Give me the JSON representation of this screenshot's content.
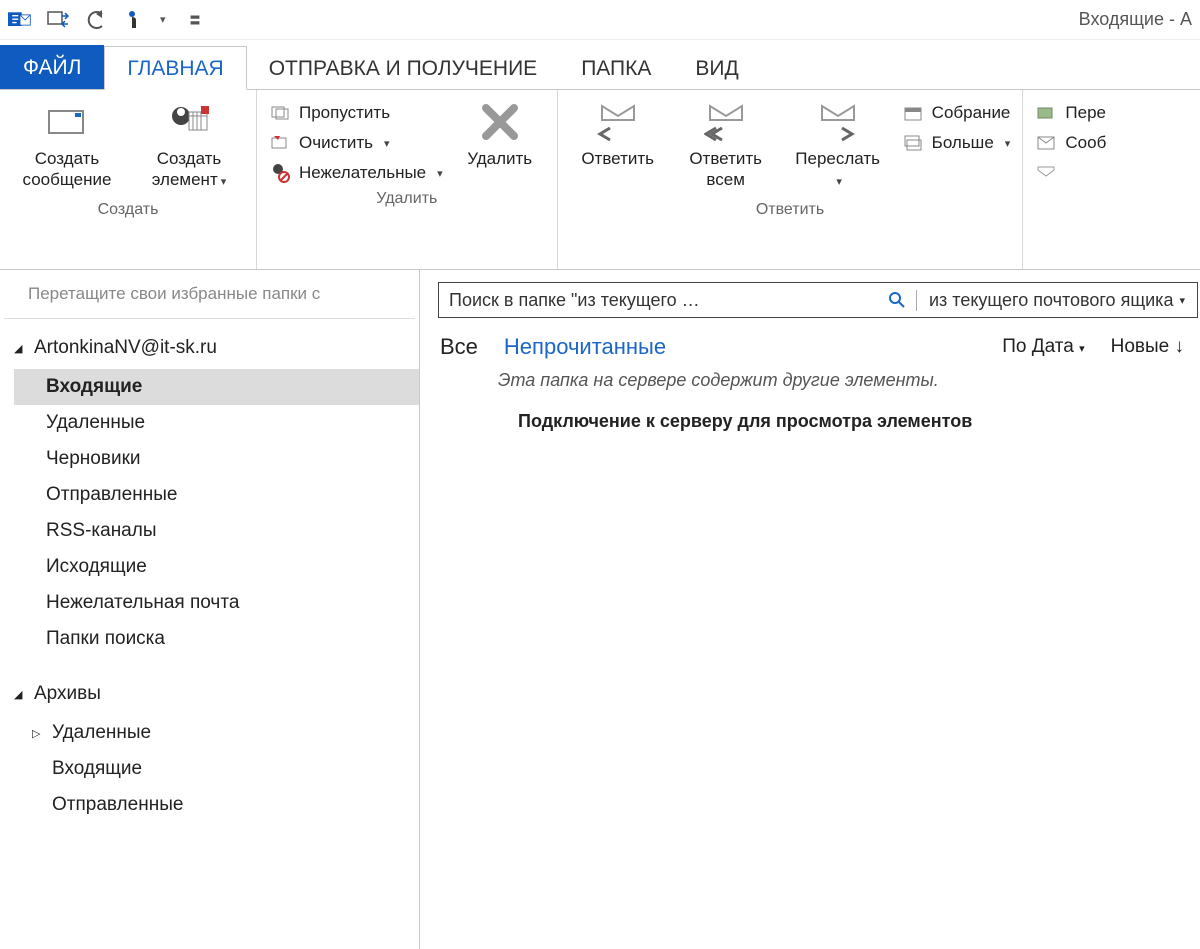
{
  "title": "Входящие - A",
  "tabs": {
    "file": "ФАЙЛ",
    "home": "ГЛАВНАЯ",
    "sendreceive": "ОТПРАВКА И ПОЛУЧЕНИЕ",
    "folder": "ПАПКА",
    "view": "ВИД"
  },
  "ribbon": {
    "create": {
      "group_label": "Создать",
      "new_email": "Создать сообщение",
      "new_item": "Создать элемент"
    },
    "delete": {
      "group_label": "Удалить",
      "ignore": "Пропустить",
      "cleanup": "Очистить",
      "junk": "Нежелательные",
      "delete": "Удалить"
    },
    "respond": {
      "group_label": "Ответить",
      "reply": "Ответить",
      "reply_all": "Ответить всем",
      "forward": "Переслать",
      "meeting": "Собрание",
      "more": "Больше"
    },
    "quicksteps": {
      "move": "Пере",
      "message": "Сооб"
    }
  },
  "sidebar": {
    "favorites_hint": "Перетащите свои избранные папки с",
    "account": "ArtonkinaNV@it-sk.ru",
    "folders": [
      "Входящие",
      "Удаленные",
      "Черновики",
      "Отправленные",
      "RSS-каналы",
      "Исходящие",
      "Нежелательная почта",
      "Папки поиска"
    ],
    "archives_label": "Архивы",
    "archive_folders": [
      "Удаленные",
      "Входящие",
      "Отправленные"
    ]
  },
  "content": {
    "search_placeholder": "Поиск в папке \"из текущего …",
    "scope": "из текущего почтового ящика",
    "filter_all": "Все",
    "filter_unread": "Непрочитанные",
    "sort_by": "По Дата",
    "sort_order": "Новые",
    "server_note": "Эта папка на сервере содержит другие элементы.",
    "connect_note": "Подключение к серверу для просмотра элементов"
  }
}
